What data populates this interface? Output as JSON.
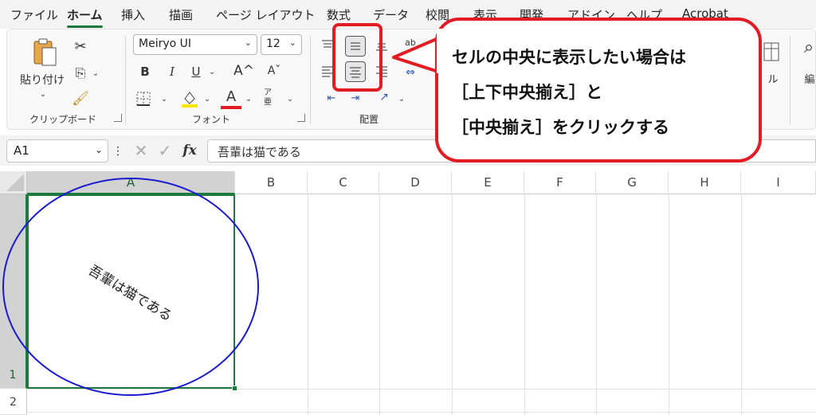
{
  "menu": {
    "tabs": [
      "ファイル",
      "ホーム",
      "挿入",
      "描画",
      "ページ レイアウト",
      "数式",
      "データ",
      "校閲",
      "表示",
      "開発",
      "アドイン",
      "ヘルプ",
      "Acrobat"
    ],
    "active_index": 1
  },
  "ribbon": {
    "clipboard": {
      "paste_label": "貼り付け",
      "group_label": "クリップボード"
    },
    "font": {
      "font_name": "Meiryo UI",
      "font_size": "12",
      "bold": "B",
      "italic": "I",
      "underline": "U",
      "grow": "A^",
      "shrink": "Aˇ",
      "font_color_glyph": "A",
      "phonetic": "ア亜",
      "group_label": "フォント",
      "highlight_color": "#ffe600",
      "font_color": "#e31b23"
    },
    "alignment": {
      "wrap_glyph": "ab",
      "group_label": "配置"
    },
    "partial_labels": {
      "cells_glyph": "ル",
      "edit_glyph": "編"
    }
  },
  "formula_bar": {
    "name_box": "A1",
    "fx": "fx",
    "value": "吾輩は猫である"
  },
  "grid": {
    "columns": [
      "A",
      "B",
      "C",
      "D",
      "E",
      "F",
      "G",
      "H",
      "I"
    ],
    "rows": [
      "1",
      "2"
    ],
    "selected_column": "A",
    "selected_row": "1",
    "cell_a1": "吾輩は猫である"
  },
  "annotation": {
    "lines": [
      "セルの中央に表示したい場合は",
      "［上下中央揃え］と",
      "［中央揃え］をクリックする"
    ],
    "border_color": "#e31b23",
    "circle_color": "#1a1ad0"
  }
}
